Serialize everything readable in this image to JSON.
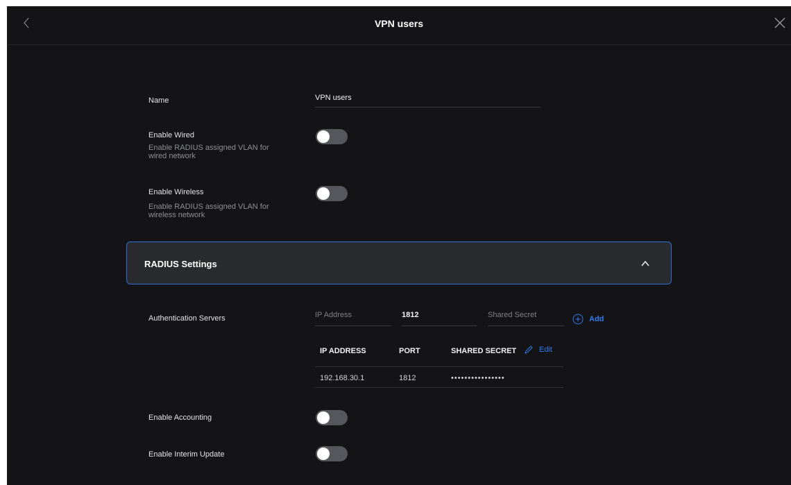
{
  "header": {
    "title": "VPN users"
  },
  "form": {
    "name_label": "Name",
    "name_value": "VPN users",
    "wired": {
      "label": "Enable Wired",
      "description": "Enable RADIUS assigned VLAN for wired network",
      "enabled": false
    },
    "wireless": {
      "label": "Enable Wireless",
      "description": "Enable RADIUS assigned VLAN for wireless network",
      "enabled": false
    }
  },
  "radius": {
    "title": "RADIUS Settings",
    "expanded": true,
    "auth_servers": {
      "label": "Authentication Servers",
      "ip_placeholder": "IP Address",
      "port_value": "1812",
      "secret_placeholder": "Shared Secret",
      "add_label": "Add"
    },
    "table": {
      "headers": [
        "IP ADDRESS",
        "PORT",
        "SHARED SECRET"
      ],
      "edit_label": "Edit",
      "rows": [
        {
          "ip": "192.168.30.1",
          "port": "1812",
          "secret": "••••••••••••••••"
        }
      ]
    },
    "accounting": {
      "label": "Enable Accounting",
      "enabled": false
    },
    "interim_update": {
      "label": "Enable Interim Update",
      "enabled": false
    }
  },
  "colors": {
    "background": "#141416",
    "panel": "#2a2b2f",
    "accent": "#2f7cf6",
    "toggle_off": "#55575c"
  }
}
